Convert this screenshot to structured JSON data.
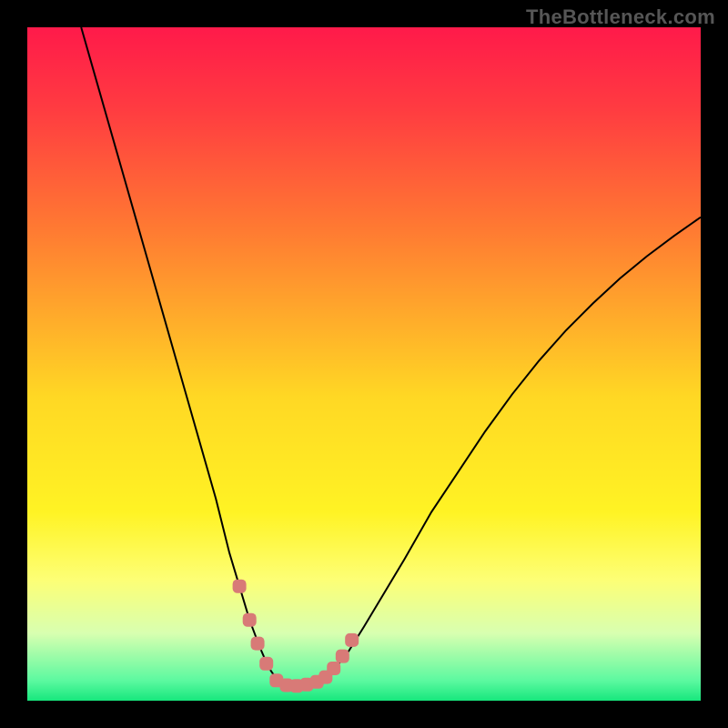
{
  "watermark": "TheBottleneck.com",
  "chart_data": {
    "type": "line",
    "title": "",
    "xlabel": "",
    "ylabel": "",
    "xlim": [
      0,
      100
    ],
    "ylim": [
      0,
      100
    ],
    "annotations": [],
    "background_gradient": {
      "stops": [
        {
          "offset": 0.0,
          "color": "#ff1a4a"
        },
        {
          "offset": 0.12,
          "color": "#ff3b41"
        },
        {
          "offset": 0.3,
          "color": "#ff7a32"
        },
        {
          "offset": 0.55,
          "color": "#ffd824"
        },
        {
          "offset": 0.72,
          "color": "#fff324"
        },
        {
          "offset": 0.82,
          "color": "#fdff75"
        },
        {
          "offset": 0.9,
          "color": "#d8ffb0"
        },
        {
          "offset": 0.97,
          "color": "#5cf9a0"
        },
        {
          "offset": 1.0,
          "color": "#17e77d"
        }
      ]
    },
    "series": [
      {
        "name": "bottleneck-curve",
        "color": "#000000",
        "type": "line",
        "x": [
          8,
          10,
          12,
          14,
          16,
          18,
          20,
          22,
          24,
          26,
          28,
          30,
          31.5,
          33,
          34.5,
          35.8,
          37.5,
          40.5,
          43,
          45,
          47.5,
          50,
          53,
          56,
          60,
          64,
          68,
          72,
          76,
          80,
          84,
          88,
          92,
          96,
          100
        ],
        "y": [
          100,
          93,
          86,
          79,
          72,
          65,
          58,
          51,
          44,
          37,
          30,
          22,
          17,
          12,
          8,
          5,
          2.5,
          2.2,
          2.6,
          4,
          7,
          11,
          16,
          21,
          28,
          34,
          40,
          45.5,
          50.5,
          55,
          59,
          62.7,
          66,
          69,
          71.8
        ]
      },
      {
        "name": "marker-band",
        "color": "#d87a77",
        "type": "scatter",
        "x": [
          31.5,
          33.0,
          34.2,
          35.5,
          37.0,
          38.5,
          40.0,
          41.5,
          43.0,
          44.3,
          45.5,
          46.8,
          48.2
        ],
        "y": [
          17.0,
          12.0,
          8.5,
          5.5,
          3.0,
          2.3,
          2.2,
          2.4,
          2.8,
          3.5,
          4.8,
          6.6,
          9.0
        ]
      }
    ]
  }
}
